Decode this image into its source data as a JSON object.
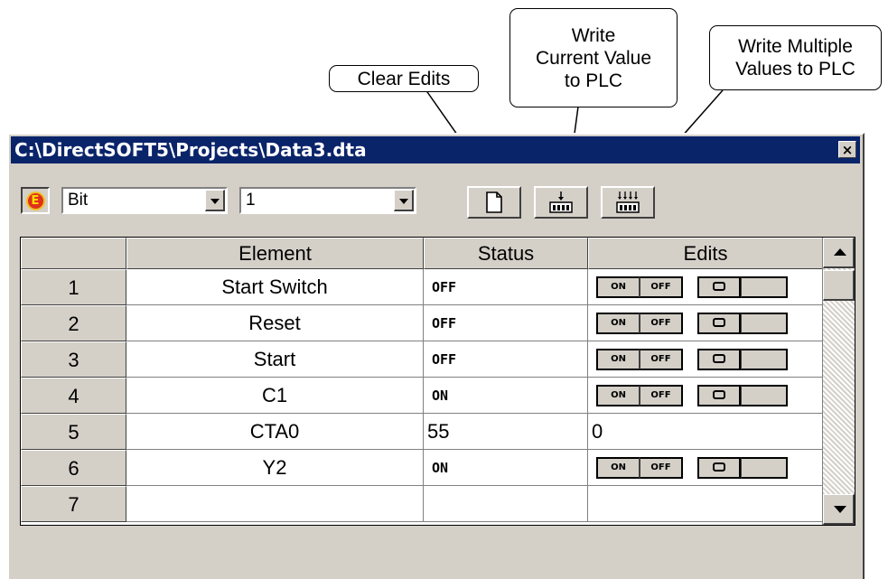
{
  "callouts": {
    "clear_edits": "Clear Edits",
    "write_current": [
      "Write",
      "Current Value",
      "to PLC"
    ],
    "write_multiple": [
      "Write Multiple",
      "Values to PLC"
    ]
  },
  "window": {
    "title": "C:\\DirectSOFT5\\Projects\\Data3.dta",
    "close_glyph": "×"
  },
  "toolbar": {
    "mode_icon": "E",
    "type_combo": "Bit",
    "format_combo": "1"
  },
  "grid": {
    "headers": {
      "element": "Element",
      "status": "Status",
      "edits": "Edits"
    },
    "rows": [
      {
        "num": "1",
        "element": "Start Switch",
        "status": "OFF",
        "edit_type": "bit"
      },
      {
        "num": "2",
        "element": "Reset",
        "status": "OFF",
        "edit_type": "bit"
      },
      {
        "num": "3",
        "element": "Start",
        "status": "OFF",
        "edit_type": "bit"
      },
      {
        "num": "4",
        "element": "C1",
        "status": "ON",
        "edit_type": "bit"
      },
      {
        "num": "5",
        "element": "CTA0",
        "status": "55",
        "edit_type": "value",
        "edit_value": "0"
      },
      {
        "num": "6",
        "element": "Y2",
        "status": "ON",
        "edit_type": "bit"
      },
      {
        "num": "7",
        "element": "",
        "status": "",
        "edit_type": "none"
      }
    ],
    "edit_labels": {
      "on": "ON",
      "off": "OFF"
    }
  },
  "colors": {
    "titlebar": "#0a246a",
    "face": "#d4d0c8",
    "badge": "#e0301e"
  }
}
